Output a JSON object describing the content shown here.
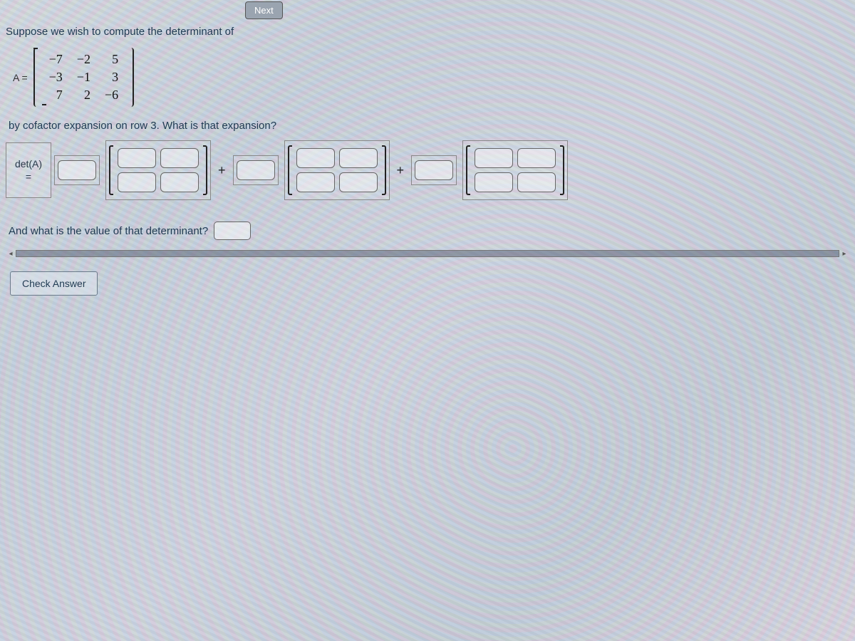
{
  "nav": {
    "next_label": "Next"
  },
  "problem": {
    "intro": "Suppose we wish to compute the determinant of",
    "matrix_label": "A =",
    "matrix": [
      [
        "−7",
        "−2",
        "5"
      ],
      [
        "−3",
        "−1",
        "3"
      ],
      [
        "7",
        "2",
        "−6"
      ]
    ],
    "cofactor_question": "by cofactor expansion on row 3. What is that expansion?",
    "det_label_top": "det(A)",
    "det_label_eq": "=",
    "plus": "+",
    "value_question": "And what is the value of that determinant?",
    "check_label": "Check Answer"
  },
  "icons": {
    "scroll_left": "◂",
    "scroll_right": "▸"
  }
}
